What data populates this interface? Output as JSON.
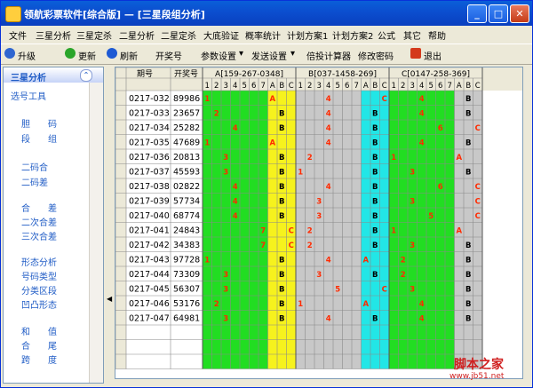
{
  "window": {
    "title": "领航彩票软件[综合版] — [三星段组分析]",
    "controls": {
      "minimize": "_",
      "maximize": "□",
      "close": "✕"
    }
  },
  "menu": [
    "文件",
    "三星分析",
    "三星定杀",
    "二星分析",
    "二星定杀",
    "大底验证",
    "概率统计",
    "计划方案1",
    "计划方案2",
    "公式",
    "其它",
    "帮助"
  ],
  "toolbar": {
    "upgrade": "升级",
    "update": "更新",
    "refresh": "刷新",
    "lottery_no": "开奖号",
    "param": "参数设置",
    "send": "发送设置",
    "calc": "倍投计算器",
    "change_pwd": "修改密码",
    "exit": "退出"
  },
  "sidebar": {
    "header": "三星分析",
    "collapse_icon": "chevron-up-icon",
    "items": [
      "选号工具",
      "胆　　码",
      "段　　组",
      "二码合",
      "二码差",
      "合　　差",
      "二次合差",
      "三次合差",
      "形态分析",
      "号码类型",
      "分类区段",
      "凹凸形态",
      "和　　值",
      "合　　尾",
      "跨　　度"
    ]
  },
  "table": {
    "col_period": "期号",
    "col_lottery": "开奖号",
    "groups": [
      "A[159-267-0348]",
      "B[037-1458-269]",
      "C[0147-258-369]"
    ],
    "sub_cols": [
      "1",
      "2",
      "3",
      "4",
      "5",
      "6",
      "7",
      "A",
      "B",
      "C"
    ],
    "rows": [
      {
        "period": "0217-032",
        "number": "89986",
        "g": [
          {
            "d": 1,
            "a": "A"
          },
          {
            "d": 4,
            "a": "C"
          },
          {
            "d": 4,
            "a": "B"
          }
        ]
      },
      {
        "period": "0217-033",
        "number": "23657",
        "g": [
          {
            "d": 2,
            "a": "B"
          },
          {
            "d": 4,
            "a": "B"
          },
          {
            "d": 4,
            "a": "B"
          }
        ]
      },
      {
        "period": "0217-034",
        "number": "25282",
        "g": [
          {
            "d": 4,
            "a": "B"
          },
          {
            "d": 4,
            "a": "B"
          },
          {
            "d": 6,
            "a": "C"
          }
        ]
      },
      {
        "period": "0217-035",
        "number": "47689",
        "g": [
          {
            "d": 1,
            "a": "A"
          },
          {
            "d": 4,
            "a": "B"
          },
          {
            "d": 4,
            "a": "B"
          }
        ]
      },
      {
        "period": "0217-036",
        "number": "20813",
        "g": [
          {
            "d": 3,
            "a": "B"
          },
          {
            "d": 2,
            "a": "B"
          },
          {
            "d": 1,
            "a": "A"
          }
        ]
      },
      {
        "period": "0217-037",
        "number": "45593",
        "g": [
          {
            "d": 3,
            "a": "B"
          },
          {
            "d": 1,
            "a": "B"
          },
          {
            "d": 3,
            "a": "B"
          }
        ]
      },
      {
        "period": "0217-038",
        "number": "02822",
        "g": [
          {
            "d": 4,
            "a": "B"
          },
          {
            "d": 4,
            "a": "B"
          },
          {
            "d": 6,
            "a": "C"
          }
        ]
      },
      {
        "period": "0217-039",
        "number": "57734",
        "g": [
          {
            "d": 4,
            "a": "B"
          },
          {
            "d": 3,
            "a": "B"
          },
          {
            "d": 3,
            "a": "C"
          }
        ]
      },
      {
        "period": "0217-040",
        "number": "68774",
        "g": [
          {
            "d": 4,
            "a": "B"
          },
          {
            "d": 3,
            "a": "B"
          },
          {
            "d": 5,
            "a": "C"
          }
        ]
      },
      {
        "period": "0217-041",
        "number": "24843",
        "g": [
          {
            "d": 7,
            "a": "C"
          },
          {
            "d": 2,
            "a": "B"
          },
          {
            "d": 1,
            "a": "A"
          }
        ]
      },
      {
        "period": "0217-042",
        "number": "34383",
        "g": [
          {
            "d": 7,
            "a": "C"
          },
          {
            "d": 2,
            "a": "B"
          },
          {
            "d": 3,
            "a": "B"
          }
        ]
      },
      {
        "period": "0217-043",
        "number": "97728",
        "g": [
          {
            "d": 1,
            "a": "B"
          },
          {
            "d": 4,
            "a": "A"
          },
          {
            "d": 2,
            "a": "B"
          }
        ]
      },
      {
        "period": "0217-044",
        "number": "73309",
        "g": [
          {
            "d": 3,
            "a": "B"
          },
          {
            "d": 3,
            "a": "B"
          },
          {
            "d": 2,
            "a": "B"
          }
        ]
      },
      {
        "period": "0217-045",
        "number": "56307",
        "g": [
          {
            "d": 3,
            "a": "B"
          },
          {
            "d": 5,
            "a": "C"
          },
          {
            "d": 3,
            "a": "B"
          }
        ]
      },
      {
        "period": "0217-046",
        "number": "53176",
        "g": [
          {
            "d": 2,
            "a": "B"
          },
          {
            "d": 1,
            "a": "A"
          },
          {
            "d": 4,
            "a": "B"
          }
        ]
      },
      {
        "period": "0217-047",
        "number": "64981",
        "g": [
          {
            "d": 3,
            "a": "B"
          },
          {
            "d": 4,
            "a": "B"
          },
          {
            "d": 4,
            "a": "B"
          }
        ]
      }
    ]
  },
  "colors": {
    "groupA_digits": "#22dd22",
    "groupA_abc": "#f6f21d",
    "groupB_digits": "#c8c8c8",
    "groupB_abc": "#22e6e6",
    "groupC_digits": "#22dd22",
    "groupC_abc": "#c8c8c8",
    "digit_text": "#ff2a00"
  },
  "watermark": "脚本之家",
  "watermark_url": "www.jb51.net"
}
